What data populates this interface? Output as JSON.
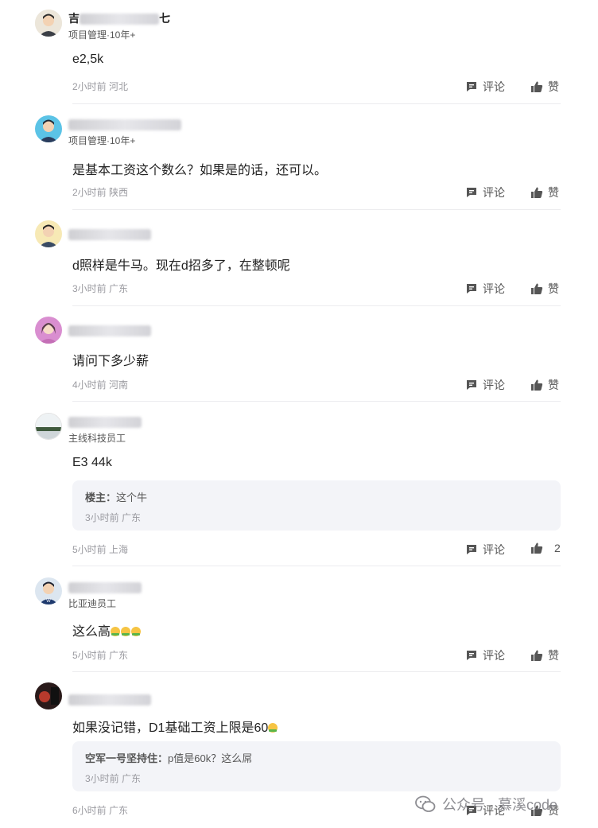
{
  "actions": {
    "comment_label": "评论",
    "like_label": "赞"
  },
  "comments": [
    {
      "name_prefix": "吉",
      "name_suffix": "七",
      "title": "项目管理·10年+",
      "text": "e2,5k",
      "time": "2小时前",
      "location": "河北",
      "likes": "赞"
    },
    {
      "name_prefix": "",
      "name_suffix": "",
      "title": "项目管理·10年+",
      "text": "是基本工资这个数么？如果是的话，还可以。",
      "time": "2小时前",
      "location": "陕西",
      "likes": "赞"
    },
    {
      "name_prefix": "",
      "name_suffix": "",
      "title": "",
      "text": "d照样是牛马。现在d招多了，在整顿呢",
      "time": "3小时前",
      "location": "广东",
      "likes": "赞"
    },
    {
      "name_prefix": "",
      "name_suffix": "",
      "title": "",
      "text": "请问下多少薪",
      "time": "4小时前",
      "location": "河南",
      "likes": "赞"
    },
    {
      "name_prefix": "",
      "name_suffix": "",
      "title": "主线科技员工",
      "text": "E3 44k",
      "time": "5小时前",
      "location": "上海",
      "likes": "2",
      "reply": {
        "author": "楼主：",
        "text": "这个牛",
        "time": "3小时前",
        "location": "广东"
      }
    },
    {
      "name_prefix": "",
      "name_suffix": "",
      "title": "比亚迪员工",
      "text": "这么高",
      "time": "5小时前",
      "location": "广东",
      "likes": "赞"
    },
    {
      "name_prefix": "",
      "name_suffix": "",
      "title": "",
      "text": "如果没记错，D1基础工资上限是60",
      "time": "6小时前",
      "location": "广东",
      "likes": "赞",
      "reply": {
        "author": "空军一号坚持住：",
        "text": "p值是60k？这么屌",
        "time": "3小时前",
        "location": "广东"
      }
    }
  ],
  "watermark": {
    "label": "公众号 · 慕溪code"
  },
  "colors": {
    "divider": "#ececef",
    "reply_bg": "#f3f4f8",
    "meta": "#9a9aa0"
  }
}
